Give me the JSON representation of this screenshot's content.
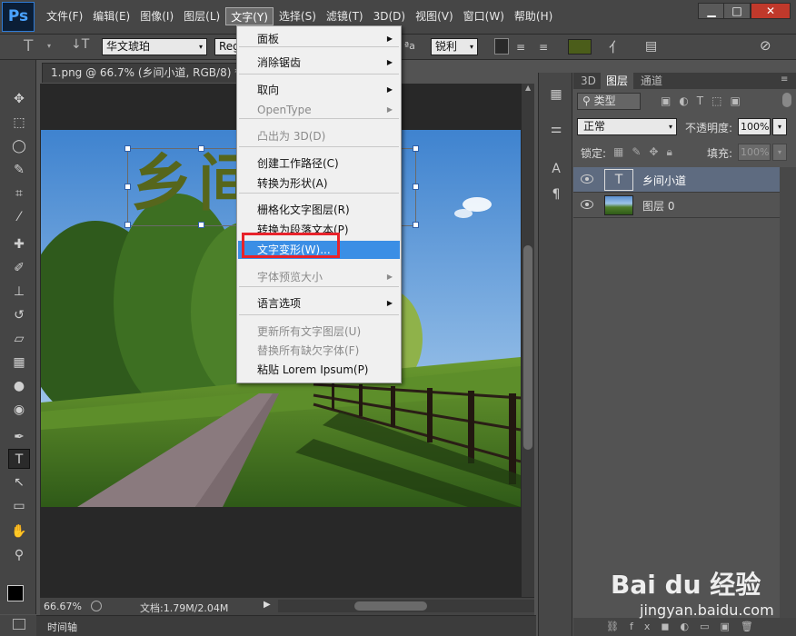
{
  "app": {
    "logo": "Ps"
  },
  "menubar": {
    "items": [
      "文件(F)",
      "编辑(E)",
      "图像(I)",
      "图层(L)",
      "文字(Y)",
      "选择(S)",
      "滤镜(T)",
      "3D(D)",
      "视图(V)",
      "窗口(W)",
      "帮助(H)"
    ],
    "active_index": 4
  },
  "window_controls": {
    "minimize": "▁",
    "maximize": "□",
    "close": "✕"
  },
  "options_bar": {
    "font_family": "华文琥珀",
    "font_style": "Reg",
    "aa_label": "ªa",
    "antialias": "锐利",
    "text_color": "#4b5d1a"
  },
  "document": {
    "tab_title": "1.png @ 66.7% (乡间小道, RGB/8) *",
    "close": "×",
    "canvas_text": "乡间小道",
    "canvas_text_color": "#56661c"
  },
  "dropdown": {
    "items": [
      {
        "label": "面板",
        "submenu": true
      },
      {
        "label": "消除锯齿",
        "submenu": true
      },
      {
        "label": "取向",
        "submenu": true
      },
      {
        "label": "OpenType",
        "submenu": true,
        "disabled": true
      },
      {
        "label": "凸出为 3D(D)",
        "disabled": true
      },
      {
        "label": "创建工作路径(C)"
      },
      {
        "label": "转换为形状(A)"
      },
      {
        "label": "栅格化文字图层(R)"
      },
      {
        "label": "转换为段落文本(P)"
      },
      {
        "label": "文字变形(W)...",
        "highlighted": true
      },
      {
        "label": "字体预览大小",
        "submenu": true,
        "disabled": true
      },
      {
        "label": "语言选项",
        "submenu": true
      },
      {
        "label": "更新所有文字图层(U)",
        "disabled": true
      },
      {
        "label": "替换所有缺欠字体(F)",
        "disabled": true
      },
      {
        "label": "粘贴 Lorem Ipsum(P)"
      }
    ]
  },
  "status": {
    "zoom": "66.67%",
    "doc_size": "文档:1.79M/2.04M"
  },
  "timeline": {
    "label": "时间轴"
  },
  "layers_panel": {
    "tabs": [
      "3D",
      "图层",
      "通道"
    ],
    "active_tab": 1,
    "filter_kind": "类型",
    "blend_mode": "正常",
    "opacity_label": "不透明度:",
    "opacity_value": "100%",
    "lock_label": "锁定:",
    "fill_label": "填充:",
    "fill_value": "100%",
    "layers": [
      {
        "name": "乡间小道",
        "type": "text",
        "thumb": "T",
        "selected": true
      },
      {
        "name": "图层 0",
        "type": "image",
        "selected": false
      }
    ]
  },
  "watermark": {
    "brand": "Bai du 经验",
    "url": "jingyan.baidu.com"
  }
}
